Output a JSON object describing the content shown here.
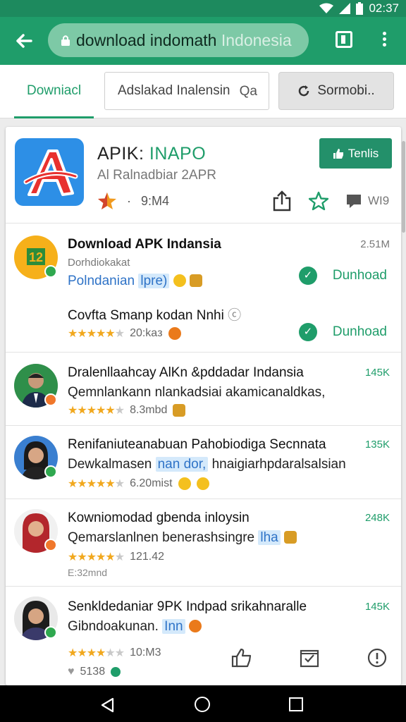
{
  "status": {
    "time": "02:37"
  },
  "browser": {
    "url_main": "download indomath",
    "url_faded": " Indonesia"
  },
  "searchbar": {
    "tab_label": "Downiacl",
    "input_value": "Adslakad Inalensin",
    "input_suffix": "Qa",
    "button_label": "Sormobi.."
  },
  "app": {
    "title_main": "APIK:",
    "title_accent": "INAPO",
    "subtitle": "Al Ralnadbiar 2APR",
    "meta": "9:М4",
    "install_label": "Tenlis",
    "action_text": "WI9"
  },
  "colors": {
    "toolbar": "#1f9d6a",
    "accent": "#1f9d6a",
    "status_bar": "#1d8a5e",
    "star": "#f1a81e",
    "link_blue": "#2f73c7"
  },
  "items": [
    {
      "title": "Download APK Indansia",
      "subtitle": "Dorhdiokakat",
      "line": "Polndanian",
      "line_hl": "lpre)",
      "size": "2.51M",
      "download_label": "Dunhoad",
      "sub_title": "Covfta Smanp kodan Nnhi",
      "sub_rating": "20:kaз",
      "sub_download_label": "Dunhoad"
    },
    {
      "title": "Dralenllaahcay AlKn &pddadar Indansia",
      "line": "Qemnlankann nlankadsiai akamicanaldkas,",
      "rating_text": "8.3mbd",
      "size": "145K"
    },
    {
      "title": "Renifaniuteanabuan Pahobiodiga Secnnata",
      "line_prefix": "Dewkalmasen",
      "line_hl": "nan dor,",
      "line_suffix": "hnaigiarhpdaralsalsian",
      "rating_text": "6.20mist",
      "size": "135K"
    },
    {
      "title": "Kowniomodad gbenda inloysin",
      "line": "Qemarslanlnen benerashsingre",
      "line_hl": "lha",
      "rating_text": "121.42",
      "extra": "E:32mnd",
      "size": "248K"
    },
    {
      "title": "Senkldedaniar 9PK Indpad srikahnaralle",
      "line": "Gibndoakunan.",
      "line_hl": "Inn",
      "rating_text": "10:M3",
      "likes": "5138",
      "size": "145K"
    }
  ]
}
